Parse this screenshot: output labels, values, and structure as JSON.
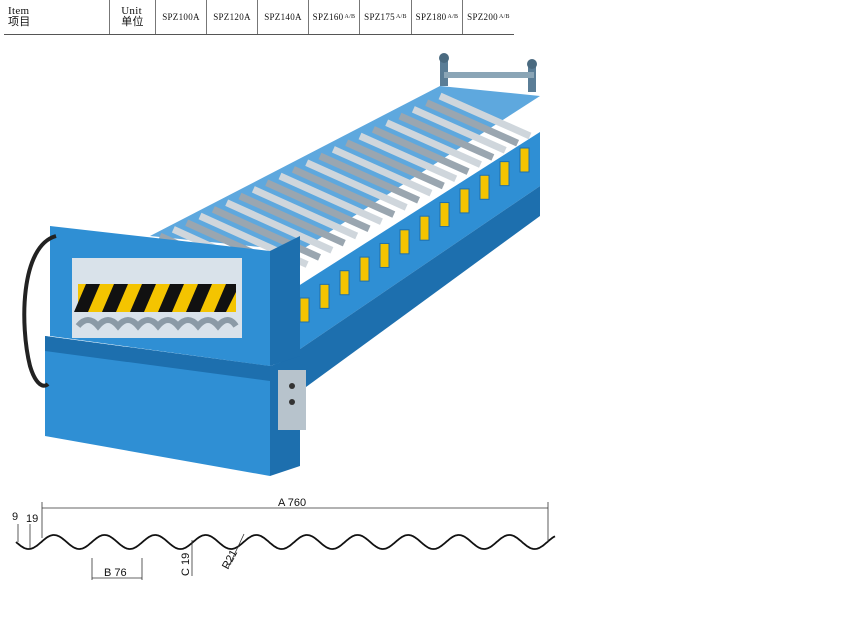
{
  "table": {
    "item_en": "Item",
    "item_cn": "项目",
    "unit_en": "Unit",
    "unit_cn": "单位",
    "models": [
      {
        "name": "SPZ100A",
        "sub": ""
      },
      {
        "name": "SPZ120A",
        "sub": ""
      },
      {
        "name": "SPZ140A",
        "sub": ""
      },
      {
        "name": "SPZ160",
        "sub": "A/B"
      },
      {
        "name": "SPZ175",
        "sub": "A/B"
      },
      {
        "name": "SPZ180",
        "sub": "A/B"
      },
      {
        "name": "SPZ200",
        "sub": "A/B"
      }
    ]
  },
  "profile": {
    "dim_a": "A 760",
    "dim_b": "B 76",
    "dim_c": "C 19",
    "dim_height": "9",
    "dim_pitch": "19",
    "dim_radius": "R21"
  },
  "colors": {
    "machine_blue": "#2f8fd4",
    "machine_dark": "#1d6fae",
    "roller": "#cfd6dc",
    "hazard_yellow": "#f4c400"
  }
}
